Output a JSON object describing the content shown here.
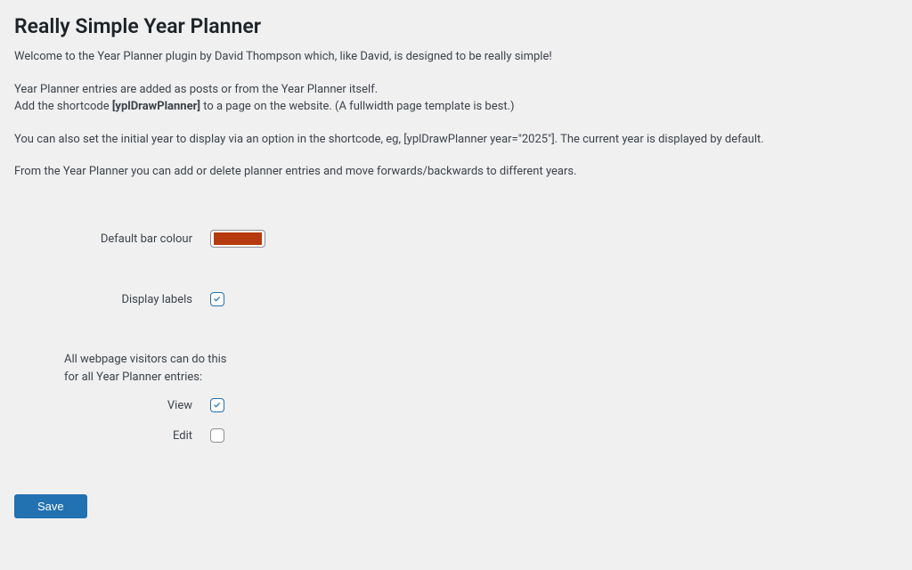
{
  "header": {
    "title": "Really Simple Year Planner"
  },
  "intro": {
    "p1": "Welcome to the Year Planner plugin by David Thompson which, like David, is designed to be really simple!",
    "p2a": "Year Planner entries are added as posts or from the Year Planner itself.",
    "p2b_pre": "Add the shortcode ",
    "p2b_bold": "[yplDrawPlanner]",
    "p2b_post": " to a page on the website. (A fullwidth page template is best.)",
    "p3": "You can also set the initial year to display via an option in the shortcode, eg, [yplDrawPlanner year=\"2025\"]. The current year is displayed by default.",
    "p4": "From the Year Planner you can add or delete planner entries and move forwards/backwards to different years."
  },
  "form": {
    "default_bar_colour_label": "Default bar colour",
    "default_bar_colour_value": "#b73a0e",
    "display_labels_label": "Display labels",
    "display_labels_checked": true,
    "permissions_text": "All webpage visitors can do this for all Year Planner entries:",
    "view_label": "View",
    "view_checked": true,
    "edit_label": "Edit",
    "edit_checked": false,
    "save_button": "Save"
  }
}
